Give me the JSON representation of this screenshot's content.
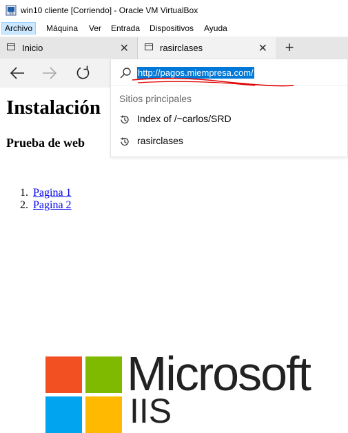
{
  "window": {
    "title": "win10 cliente [Corriendo] - Oracle VM VirtualBox",
    "icon": "virtualbox-icon"
  },
  "menubar": {
    "items": [
      {
        "label": "Archivo",
        "active": true
      },
      {
        "label": "Máquina",
        "active": false
      },
      {
        "label": "Ver",
        "active": false
      },
      {
        "label": "Entrada",
        "active": false
      },
      {
        "label": "Dispositivos",
        "active": false
      },
      {
        "label": "Ayuda",
        "active": false
      }
    ]
  },
  "tabs": [
    {
      "label": "Inicio",
      "icon": "tab-page-icon",
      "close": "✕"
    },
    {
      "label": "rasirclases",
      "icon": "tab-page-icon",
      "close": "✕"
    }
  ],
  "newtab": {
    "label": "+"
  },
  "nav": {
    "back_icon": "back-arrow-icon",
    "forward_icon": "forward-arrow-icon",
    "refresh_icon": "refresh-icon"
  },
  "address": {
    "value": "http://pagos.miempresa.com/",
    "selected": true,
    "selection_color": "#0078d7"
  },
  "suggestions": {
    "header": "Sitios principales",
    "items": [
      {
        "label": "Index of /~carlos/SRD",
        "icon": "history-icon"
      },
      {
        "label": "rasirclases",
        "icon": "history-icon"
      }
    ]
  },
  "page": {
    "heading": "Instalación",
    "subheading": "Prueba de web",
    "links": [
      {
        "num": "1.",
        "label": "Pagina 1"
      },
      {
        "num": "2.",
        "label": "Pagina 2"
      }
    ],
    "logo_text": "Microsoft",
    "logo_subtext": "IIS",
    "logo_colors": [
      "#f25022",
      "#7fba00",
      "#00a4ef",
      "#ffb900"
    ]
  },
  "annotation": {
    "color": "#e00000"
  }
}
